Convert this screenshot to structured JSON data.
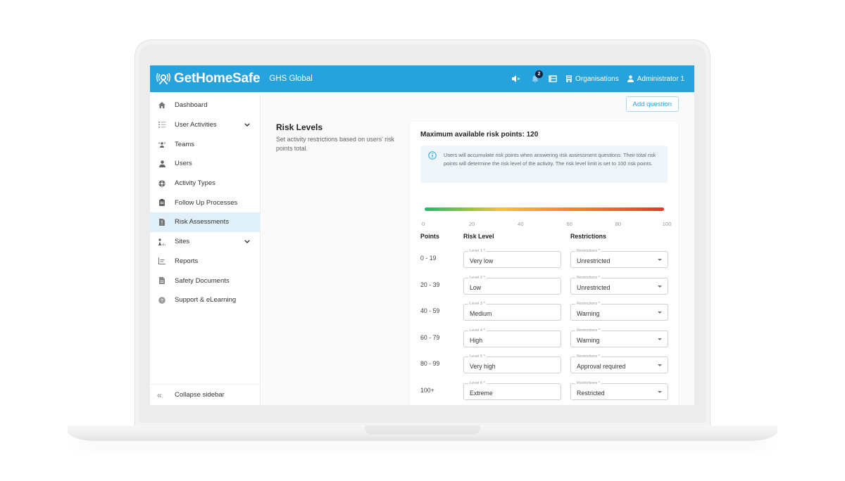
{
  "header": {
    "brand": "GetHomeSafe",
    "org_name": "GHS Global",
    "notification_count": "2",
    "organisations_label": "Organisations",
    "user_label": "Administrator 1",
    "icons": [
      "volume-mute-icon",
      "bell-icon",
      "phone-icon",
      "building-icon",
      "user-icon"
    ]
  },
  "sidebar": {
    "items": [
      {
        "label": "Dashboard",
        "icon": "home-icon",
        "has_chevron": false,
        "active": false
      },
      {
        "label": "User Activities",
        "icon": "list-icon",
        "has_chevron": true,
        "active": false
      },
      {
        "label": "Teams",
        "icon": "team-icon",
        "has_chevron": false,
        "active": false
      },
      {
        "label": "Users",
        "icon": "user-icon",
        "has_chevron": false,
        "active": false
      },
      {
        "label": "Activity Types",
        "icon": "activity-icon",
        "has_chevron": false,
        "active": false
      },
      {
        "label": "Follow Up Processes",
        "icon": "clipboard-icon",
        "has_chevron": false,
        "active": false
      },
      {
        "label": "Risk Assessments",
        "icon": "document-alert-icon",
        "has_chevron": false,
        "active": true
      },
      {
        "label": "Sites",
        "icon": "sites-icon",
        "has_chevron": true,
        "active": false
      },
      {
        "label": "Reports",
        "icon": "chart-icon",
        "has_chevron": false,
        "active": false
      },
      {
        "label": "Safety Documents",
        "icon": "document-icon",
        "has_chevron": false,
        "active": false
      },
      {
        "label": "Support & eLearning",
        "icon": "help-icon",
        "has_chevron": false,
        "active": false
      }
    ],
    "collapse_label": "Collapse sidebar"
  },
  "main": {
    "add_question_label": "Add question",
    "section_title": "Risk Levels",
    "section_description": "Set activity restrictions based on users' risk points total.",
    "max_points_label": "Maximum available risk points: 120",
    "info_text": "Users will accumulate risk points when answering risk assessment questions. Their total risk points will determine the risk level of the activity. The risk level limit is set to 100 risk points.",
    "scale_ticks": [
      "0",
      "20",
      "40",
      "60",
      "80",
      "100"
    ],
    "columns": {
      "points": "Points",
      "risk_level": "Risk Level",
      "restrictions": "Restrictions"
    },
    "levels": [
      {
        "points": "0 - 19",
        "level_label": "Level 1 *",
        "level_value": "Very low",
        "restr_label": "Restrictions *",
        "restr_value": "Unrestricted"
      },
      {
        "points": "20 - 39",
        "level_label": "Level 2 *",
        "level_value": "Low",
        "restr_label": "Restrictions *",
        "restr_value": "Unrestricted"
      },
      {
        "points": "40 - 59",
        "level_label": "Level 3 *",
        "level_value": "Medium",
        "restr_label": "Restrictions *",
        "restr_value": "Warning"
      },
      {
        "points": "60 - 79",
        "level_label": "Level 4 *",
        "level_value": "High",
        "restr_label": "Restrictions *",
        "restr_value": "Warning"
      },
      {
        "points": "80 - 99",
        "level_label": "Level 5 *",
        "level_value": "Very high",
        "restr_label": "Restrictions *",
        "restr_value": "Approval required"
      },
      {
        "points": "100+",
        "level_label": "Level 6 *",
        "level_value": "Extreme",
        "restr_label": "Restrictions *",
        "restr_value": "Restricted"
      }
    ]
  },
  "colors": {
    "brand": "#26a3dd",
    "active_nav_bg": "#e0f0fa",
    "info_bg": "#eef6fc",
    "badge": "#0c2340",
    "scale": [
      "#1dbb72",
      "#fac12d",
      "#f89a2c",
      "#e43927"
    ]
  }
}
